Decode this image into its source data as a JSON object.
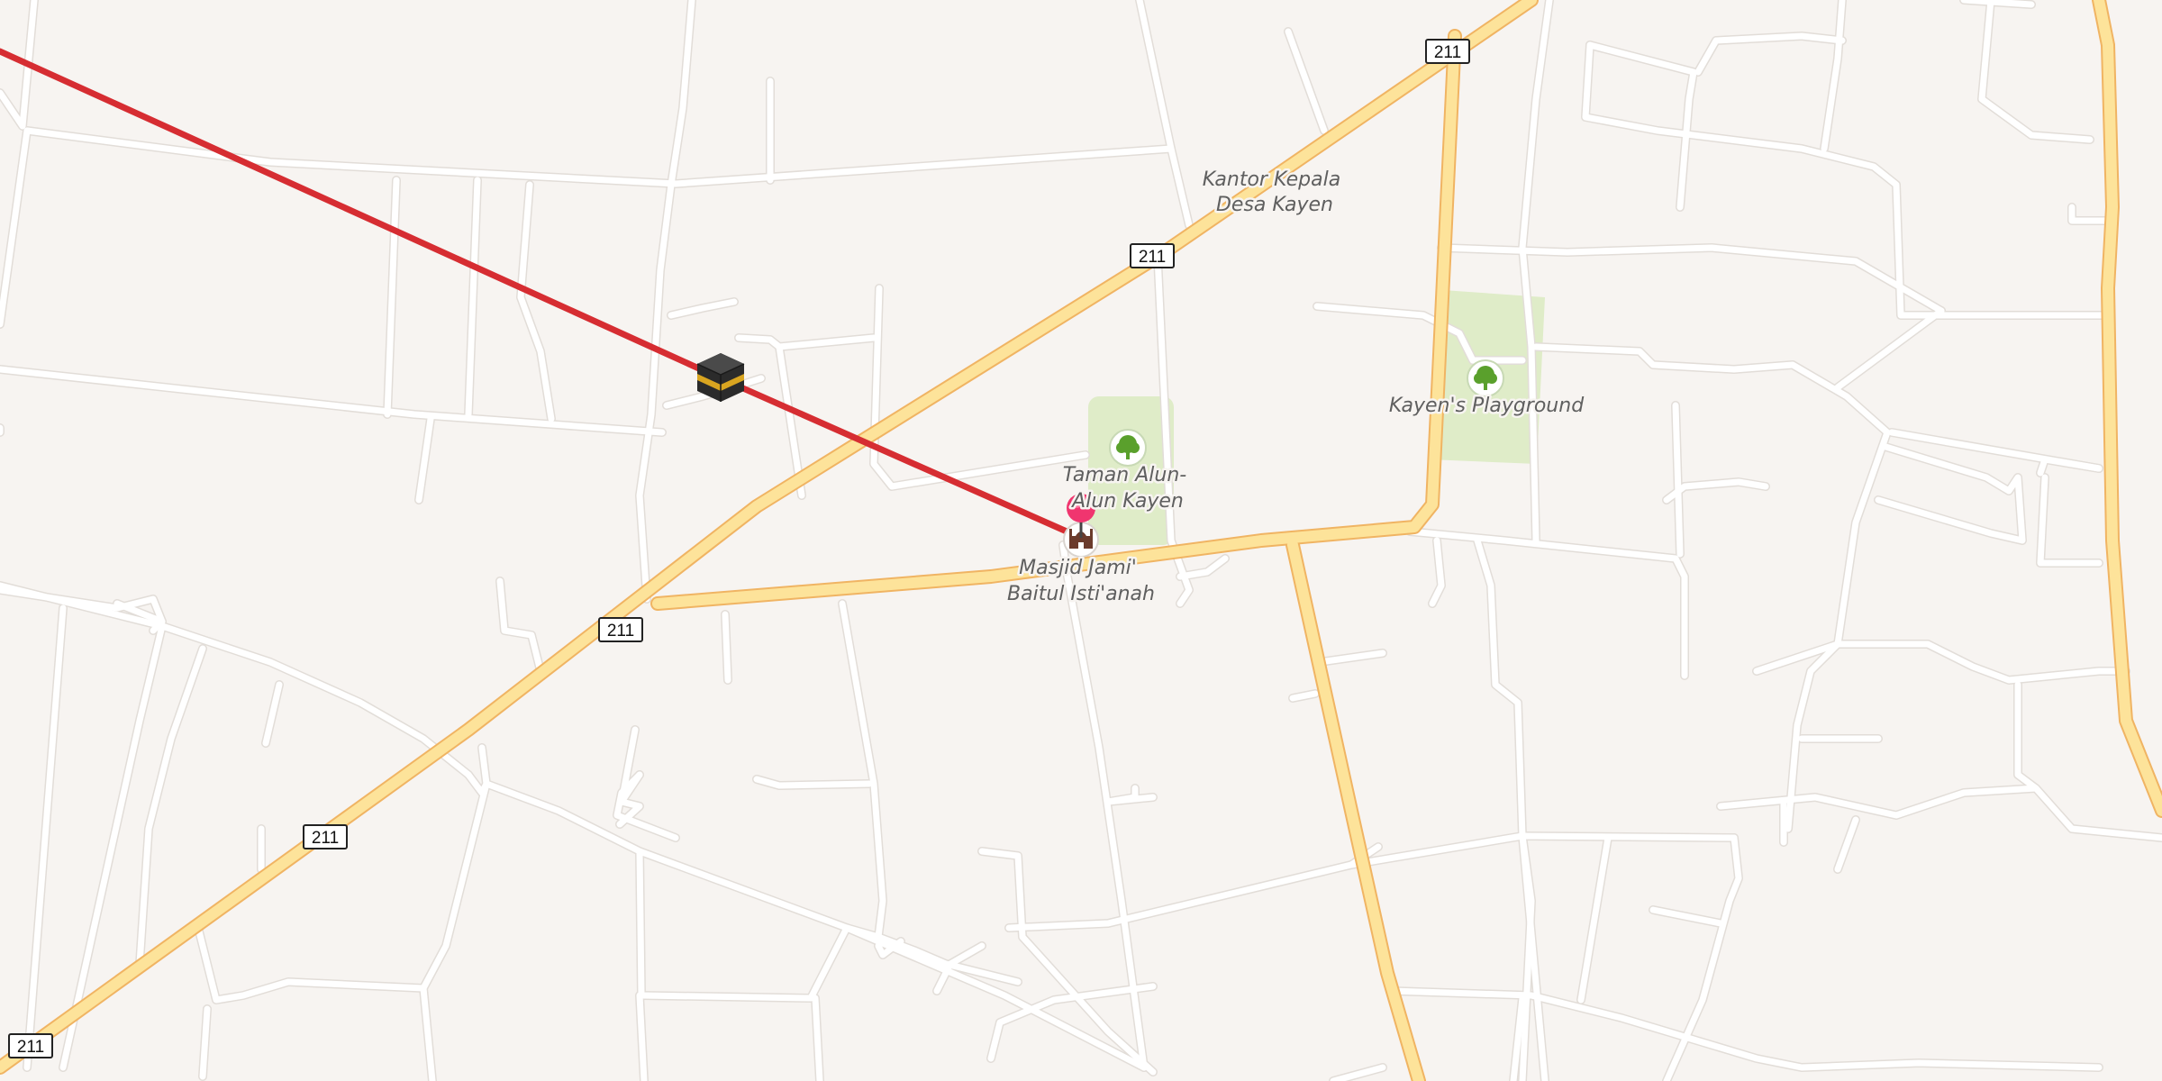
{
  "map": {
    "road_shields": [
      "211",
      "211",
      "211",
      "211",
      "211"
    ],
    "labels": {
      "kantor_kepala": [
        "Kantor Kepala",
        "Desa Kayen"
      ],
      "taman_alun": [
        "Taman Alun-",
        "Alun Kayen"
      ],
      "masjid": [
        "Masjid Jami'",
        "Baitul Isti'anah"
      ],
      "kayens_playground": "Kayen's Playground"
    },
    "markers": {
      "kaaba": "kaaba-icon",
      "destination_pin": "location-pin-icon",
      "mosque": "mosque-icon",
      "park_tree": "tree-icon"
    },
    "colors": {
      "background": "#f7f4f1",
      "route_line": "#d62d32",
      "major_road": "#fde39a",
      "major_road_casing": "#f0b463",
      "park": "#dfecc8",
      "pin": "#f0356f"
    }
  }
}
